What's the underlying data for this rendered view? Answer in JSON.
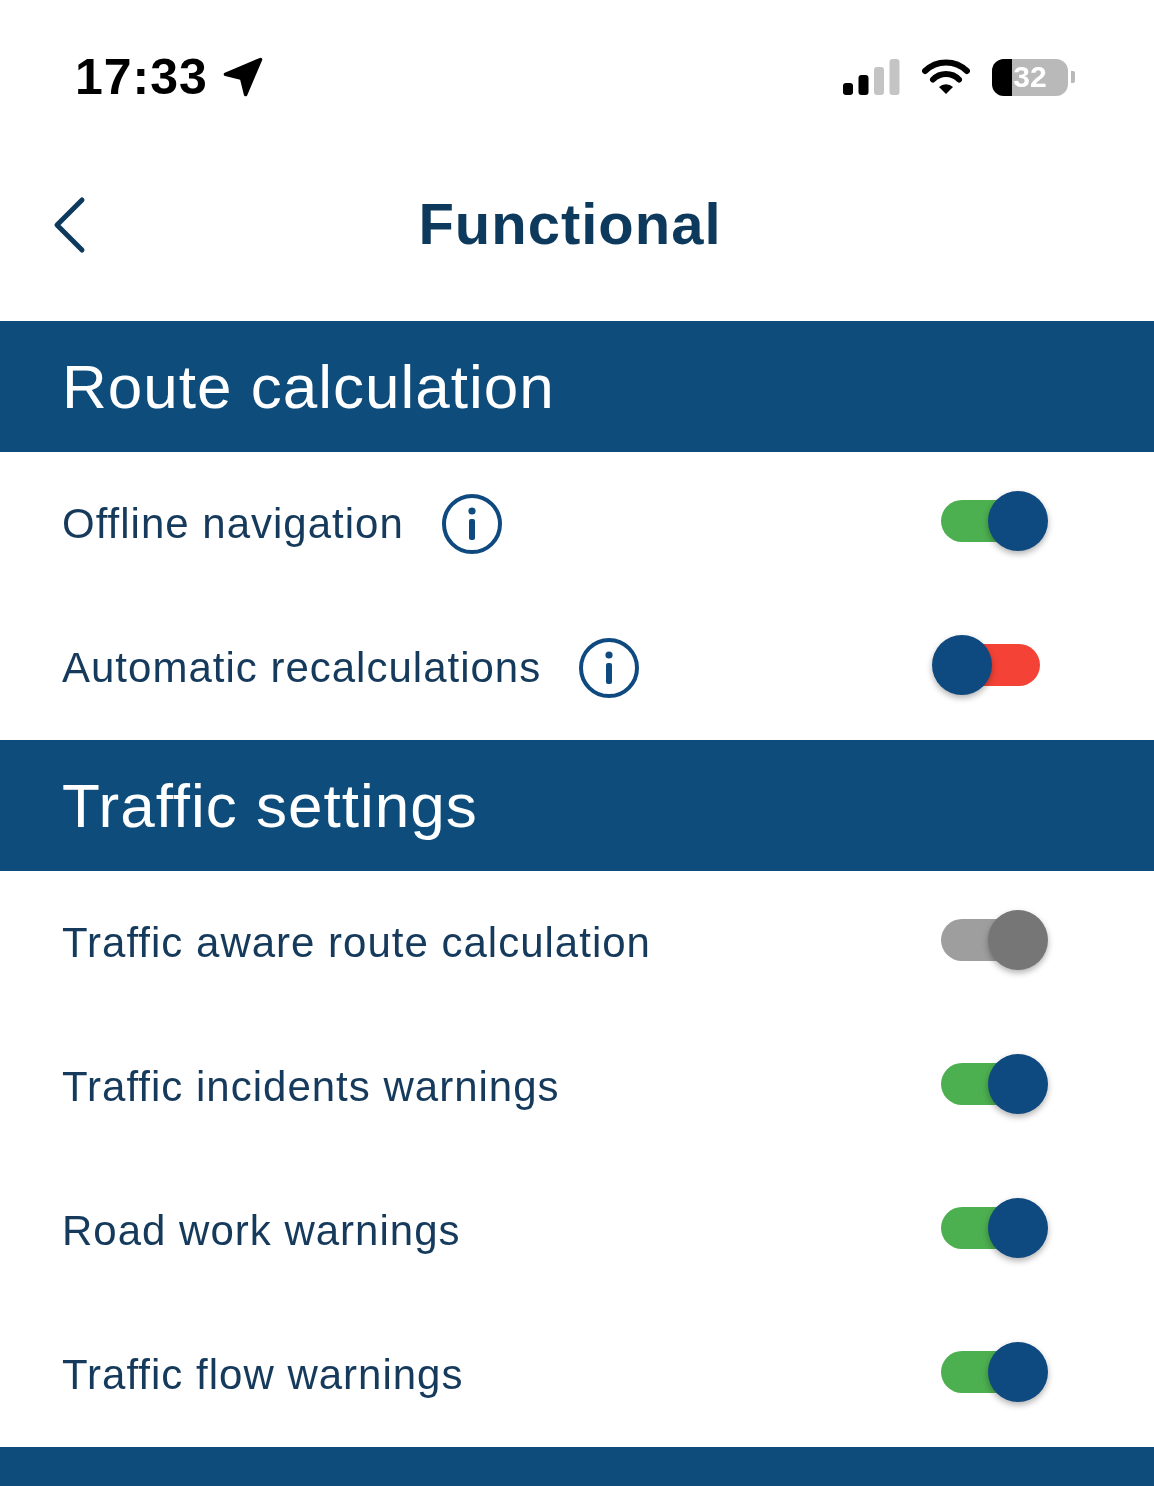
{
  "status_bar": {
    "time": "17:33",
    "battery": "32"
  },
  "nav": {
    "title": "Functional"
  },
  "sections": [
    {
      "title": "Route calculation",
      "rows": [
        {
          "label": "Offline navigation",
          "info": true,
          "on": true,
          "disabled": false
        },
        {
          "label": "Automatic recalculations",
          "info": true,
          "on": false,
          "disabled": false
        }
      ]
    },
    {
      "title": "Traffic settings",
      "rows": [
        {
          "label": "Traffic aware route calculation",
          "info": false,
          "on": true,
          "disabled": true
        },
        {
          "label": "Traffic incidents warnings",
          "info": false,
          "on": true,
          "disabled": false
        },
        {
          "label": "Road work warnings",
          "info": false,
          "on": true,
          "disabled": false
        },
        {
          "label": "Traffic flow warnings",
          "info": false,
          "on": true,
          "disabled": false
        }
      ]
    }
  ],
  "more_sections_below": true
}
